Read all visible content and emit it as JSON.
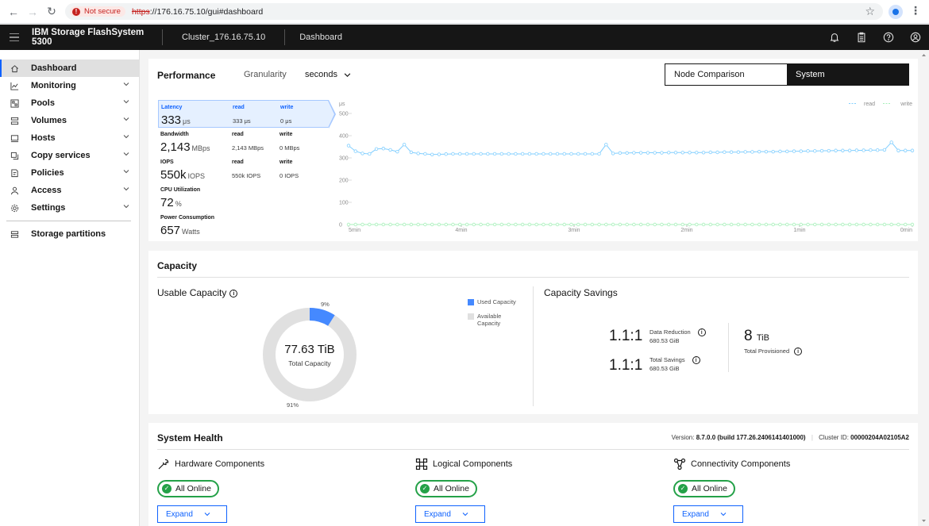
{
  "browser": {
    "not_secure": "Not secure",
    "url_https": "https",
    "url_rest": "://176.16.75.10/gui#dashboard"
  },
  "header": {
    "brand": "IBM Storage FlashSystem 5300",
    "cluster": "Cluster_176.16.75.10",
    "page": "Dashboard"
  },
  "sidebar": {
    "items": [
      {
        "label": "Dashboard",
        "icon": "home-icon"
      },
      {
        "label": "Monitoring",
        "icon": "chart-icon"
      },
      {
        "label": "Pools",
        "icon": "pools-icon"
      },
      {
        "label": "Volumes",
        "icon": "volumes-icon"
      },
      {
        "label": "Hosts",
        "icon": "hosts-icon"
      },
      {
        "label": "Copy services",
        "icon": "copy-icon"
      },
      {
        "label": "Policies",
        "icon": "policies-icon"
      },
      {
        "label": "Access",
        "icon": "user-icon"
      },
      {
        "label": "Settings",
        "icon": "gear-icon"
      }
    ],
    "extra": {
      "label": "Storage partitions",
      "icon": "partitions-icon"
    }
  },
  "performance": {
    "title": "Performance",
    "granularity_label": "Granularity",
    "granularity_value": "seconds",
    "toggle": [
      "Node Comparison",
      "System"
    ],
    "metrics": [
      {
        "label": "Latency",
        "value": "333",
        "unit": "μs",
        "read_label": "read",
        "read": "333 μs",
        "write_label": "write",
        "write": "0 μs"
      },
      {
        "label": "Bandwidth",
        "value": "2,143",
        "unit": "MBps",
        "read_label": "read",
        "read": "2,143 MBps",
        "write_label": "write",
        "write": "0 MBps"
      },
      {
        "label": "IOPS",
        "value": "550k",
        "unit": "IOPS",
        "read_label": "read",
        "read": "550k IOPS",
        "write_label": "write",
        "write": "0 IOPS"
      },
      {
        "label": "CPU Utilization",
        "value": "72",
        "unit": "%"
      },
      {
        "label": "Power Consumption",
        "value": "657",
        "unit": "Watts"
      }
    ],
    "chart_data": {
      "type": "line",
      "ylabel": "μs",
      "ylim": [
        0,
        500
      ],
      "yticks": [
        0,
        100,
        200,
        300,
        400,
        500
      ],
      "xticks": [
        "5min",
        "4min",
        "3min",
        "2min",
        "1min",
        "0min"
      ],
      "legend": [
        "read",
        "write"
      ],
      "legend_position": "top-right",
      "series": [
        {
          "name": "read",
          "color": "#82cfff",
          "values": [
            355,
            330,
            320,
            318,
            340,
            342,
            336,
            328,
            360,
            325,
            320,
            318,
            315,
            316,
            317,
            318,
            318,
            318,
            318,
            318,
            318,
            318,
            318,
            318,
            318,
            318,
            318,
            318,
            318,
            318,
            318,
            318,
            318,
            318,
            318,
            318,
            318,
            360,
            320,
            322,
            322,
            323,
            323,
            323,
            323,
            323,
            324,
            324,
            324,
            324,
            324,
            324,
            325,
            325,
            326,
            326,
            326,
            327,
            327,
            328,
            328,
            328,
            329,
            329,
            330,
            330,
            331,
            331,
            332,
            332,
            333,
            333,
            333,
            334,
            334,
            335,
            335,
            336,
            370,
            333,
            333,
            333
          ]
        },
        {
          "name": "write",
          "color": "#a7f0ba",
          "values": [
            0,
            0,
            0,
            0,
            0,
            0,
            0,
            0,
            0,
            0,
            0,
            0,
            0,
            0,
            0,
            0,
            0,
            0,
            0,
            0,
            0,
            0,
            0,
            0,
            0,
            0,
            0,
            0,
            0,
            0,
            0,
            0,
            0,
            0,
            0,
            0,
            0,
            0,
            0,
            0,
            0,
            0,
            0,
            0,
            0,
            0,
            0,
            0,
            0,
            0,
            0,
            0,
            0,
            0,
            0,
            0,
            0,
            0,
            0,
            0,
            0,
            0,
            0,
            0,
            0,
            0,
            0,
            0,
            0,
            0,
            0,
            0,
            0,
            0,
            0,
            0,
            0,
            0,
            0,
            0,
            0,
            0
          ]
        }
      ]
    }
  },
  "capacity": {
    "title": "Capacity",
    "usable_title": "Usable Capacity",
    "total_value": "77.63 TiB",
    "total_label": "Total Capacity",
    "used_pct": "9%",
    "available_pct": "91%",
    "used_fraction": 0.09,
    "legend_used": "Used Capacity",
    "legend_available": "Available Capacity",
    "used_color": "#4589ff",
    "available_color": "#e0e0e0",
    "savings_title": "Capacity Savings",
    "data_reduction_ratio": "1.1:1",
    "data_reduction_label": "Data Reduction",
    "data_reduction_value": "680.53 GiB",
    "total_savings_ratio": "1.1:1",
    "total_savings_label": "Total Savings",
    "total_savings_value": "680.53 GiB",
    "provisioned_value": "8",
    "provisioned_unit": "TiB",
    "provisioned_label": "Total Provisioned"
  },
  "health": {
    "title": "System Health",
    "version_label": "Version:",
    "version_value": "8.7.0.0 (build 177.26.2406141401000)",
    "cluster_label": "Cluster ID:",
    "cluster_value": "00000204A02105A2",
    "components": [
      {
        "title": "Hardware Components",
        "icon": "wrench-icon",
        "status": "All Online",
        "expand": "Expand"
      },
      {
        "title": "Logical Components",
        "icon": "logical-icon",
        "status": "All Online",
        "expand": "Expand"
      },
      {
        "title": "Connectivity Components",
        "icon": "connectivity-icon",
        "status": "All Online",
        "expand": "Expand"
      }
    ]
  }
}
